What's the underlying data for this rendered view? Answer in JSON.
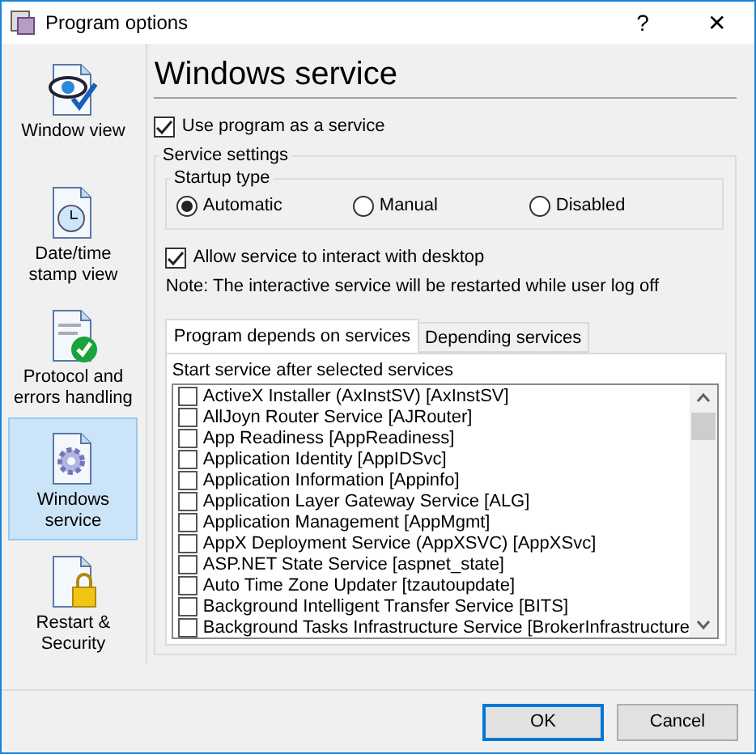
{
  "window": {
    "title": "Program options",
    "help": "?",
    "close": "✕"
  },
  "sidebar": {
    "items": [
      {
        "label": "Window view",
        "kind": "eye",
        "selected": false
      },
      {
        "label": "Date/time stamp view",
        "kind": "clock",
        "selected": false
      },
      {
        "label": "Protocol and errors handling",
        "kind": "check",
        "selected": false
      },
      {
        "label": "Windows service",
        "kind": "gear",
        "selected": true
      },
      {
        "label": "Restart & Security",
        "kind": "lock",
        "selected": false
      }
    ]
  },
  "heading": "Windows service",
  "use_as_service": {
    "label": "Use program as a service",
    "checked": true
  },
  "service_settings": {
    "title": "Service settings",
    "startup_type": {
      "title": "Startup type",
      "options": [
        {
          "label": "Automatic",
          "selected": true
        },
        {
          "label": "Manual",
          "selected": false
        },
        {
          "label": "Disabled",
          "selected": false
        }
      ]
    },
    "interact": {
      "label": "Allow service to interact with desktop",
      "checked": true
    },
    "note": "Note: The interactive service will be restarted while user log off",
    "tabs": [
      {
        "label": "Program depends on services",
        "selected": true
      },
      {
        "label": "Depending services",
        "selected": false
      }
    ],
    "list_caption": "Start service after selected services",
    "services": [
      {
        "label": "ActiveX Installer (AxInstSV) [AxInstSV]",
        "checked": false
      },
      {
        "label": "AllJoyn Router Service [AJRouter]",
        "checked": false
      },
      {
        "label": "App Readiness [AppReadiness]",
        "checked": false
      },
      {
        "label": "Application Identity [AppIDSvc]",
        "checked": false
      },
      {
        "label": "Application Information [Appinfo]",
        "checked": false
      },
      {
        "label": "Application Layer Gateway Service [ALG]",
        "checked": false
      },
      {
        "label": "Application Management [AppMgmt]",
        "checked": false
      },
      {
        "label": "AppX Deployment Service (AppXSVC) [AppXSvc]",
        "checked": false
      },
      {
        "label": "ASP.NET State Service [aspnet_state]",
        "checked": false
      },
      {
        "label": "Auto Time Zone Updater [tzautoupdate]",
        "checked": false
      },
      {
        "label": "Background Intelligent Transfer Service [BITS]",
        "checked": false
      },
      {
        "label": "Background Tasks Infrastructure Service [BrokerInfrastructure",
        "checked": false
      }
    ]
  },
  "buttons": [
    {
      "label": "OK",
      "kind": "default"
    },
    {
      "label": "Cancel",
      "kind": "normal"
    }
  ]
}
